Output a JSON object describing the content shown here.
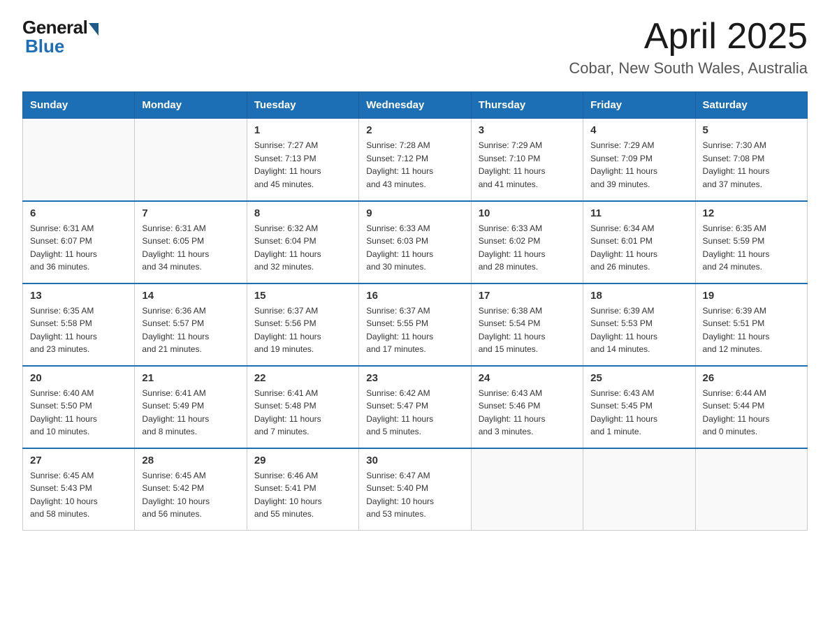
{
  "header": {
    "logo_general": "General",
    "logo_blue": "Blue",
    "title": "April 2025",
    "subtitle": "Cobar, New South Wales, Australia"
  },
  "weekdays": [
    "Sunday",
    "Monday",
    "Tuesday",
    "Wednesday",
    "Thursday",
    "Friday",
    "Saturday"
  ],
  "weeks": [
    [
      {
        "day": "",
        "info": ""
      },
      {
        "day": "",
        "info": ""
      },
      {
        "day": "1",
        "info": "Sunrise: 7:27 AM\nSunset: 7:13 PM\nDaylight: 11 hours\nand 45 minutes."
      },
      {
        "day": "2",
        "info": "Sunrise: 7:28 AM\nSunset: 7:12 PM\nDaylight: 11 hours\nand 43 minutes."
      },
      {
        "day": "3",
        "info": "Sunrise: 7:29 AM\nSunset: 7:10 PM\nDaylight: 11 hours\nand 41 minutes."
      },
      {
        "day": "4",
        "info": "Sunrise: 7:29 AM\nSunset: 7:09 PM\nDaylight: 11 hours\nand 39 minutes."
      },
      {
        "day": "5",
        "info": "Sunrise: 7:30 AM\nSunset: 7:08 PM\nDaylight: 11 hours\nand 37 minutes."
      }
    ],
    [
      {
        "day": "6",
        "info": "Sunrise: 6:31 AM\nSunset: 6:07 PM\nDaylight: 11 hours\nand 36 minutes."
      },
      {
        "day": "7",
        "info": "Sunrise: 6:31 AM\nSunset: 6:05 PM\nDaylight: 11 hours\nand 34 minutes."
      },
      {
        "day": "8",
        "info": "Sunrise: 6:32 AM\nSunset: 6:04 PM\nDaylight: 11 hours\nand 32 minutes."
      },
      {
        "day": "9",
        "info": "Sunrise: 6:33 AM\nSunset: 6:03 PM\nDaylight: 11 hours\nand 30 minutes."
      },
      {
        "day": "10",
        "info": "Sunrise: 6:33 AM\nSunset: 6:02 PM\nDaylight: 11 hours\nand 28 minutes."
      },
      {
        "day": "11",
        "info": "Sunrise: 6:34 AM\nSunset: 6:01 PM\nDaylight: 11 hours\nand 26 minutes."
      },
      {
        "day": "12",
        "info": "Sunrise: 6:35 AM\nSunset: 5:59 PM\nDaylight: 11 hours\nand 24 minutes."
      }
    ],
    [
      {
        "day": "13",
        "info": "Sunrise: 6:35 AM\nSunset: 5:58 PM\nDaylight: 11 hours\nand 23 minutes."
      },
      {
        "day": "14",
        "info": "Sunrise: 6:36 AM\nSunset: 5:57 PM\nDaylight: 11 hours\nand 21 minutes."
      },
      {
        "day": "15",
        "info": "Sunrise: 6:37 AM\nSunset: 5:56 PM\nDaylight: 11 hours\nand 19 minutes."
      },
      {
        "day": "16",
        "info": "Sunrise: 6:37 AM\nSunset: 5:55 PM\nDaylight: 11 hours\nand 17 minutes."
      },
      {
        "day": "17",
        "info": "Sunrise: 6:38 AM\nSunset: 5:54 PM\nDaylight: 11 hours\nand 15 minutes."
      },
      {
        "day": "18",
        "info": "Sunrise: 6:39 AM\nSunset: 5:53 PM\nDaylight: 11 hours\nand 14 minutes."
      },
      {
        "day": "19",
        "info": "Sunrise: 6:39 AM\nSunset: 5:51 PM\nDaylight: 11 hours\nand 12 minutes."
      }
    ],
    [
      {
        "day": "20",
        "info": "Sunrise: 6:40 AM\nSunset: 5:50 PM\nDaylight: 11 hours\nand 10 minutes."
      },
      {
        "day": "21",
        "info": "Sunrise: 6:41 AM\nSunset: 5:49 PM\nDaylight: 11 hours\nand 8 minutes."
      },
      {
        "day": "22",
        "info": "Sunrise: 6:41 AM\nSunset: 5:48 PM\nDaylight: 11 hours\nand 7 minutes."
      },
      {
        "day": "23",
        "info": "Sunrise: 6:42 AM\nSunset: 5:47 PM\nDaylight: 11 hours\nand 5 minutes."
      },
      {
        "day": "24",
        "info": "Sunrise: 6:43 AM\nSunset: 5:46 PM\nDaylight: 11 hours\nand 3 minutes."
      },
      {
        "day": "25",
        "info": "Sunrise: 6:43 AM\nSunset: 5:45 PM\nDaylight: 11 hours\nand 1 minute."
      },
      {
        "day": "26",
        "info": "Sunrise: 6:44 AM\nSunset: 5:44 PM\nDaylight: 11 hours\nand 0 minutes."
      }
    ],
    [
      {
        "day": "27",
        "info": "Sunrise: 6:45 AM\nSunset: 5:43 PM\nDaylight: 10 hours\nand 58 minutes."
      },
      {
        "day": "28",
        "info": "Sunrise: 6:45 AM\nSunset: 5:42 PM\nDaylight: 10 hours\nand 56 minutes."
      },
      {
        "day": "29",
        "info": "Sunrise: 6:46 AM\nSunset: 5:41 PM\nDaylight: 10 hours\nand 55 minutes."
      },
      {
        "day": "30",
        "info": "Sunrise: 6:47 AM\nSunset: 5:40 PM\nDaylight: 10 hours\nand 53 minutes."
      },
      {
        "day": "",
        "info": ""
      },
      {
        "day": "",
        "info": ""
      },
      {
        "day": "",
        "info": ""
      }
    ]
  ]
}
